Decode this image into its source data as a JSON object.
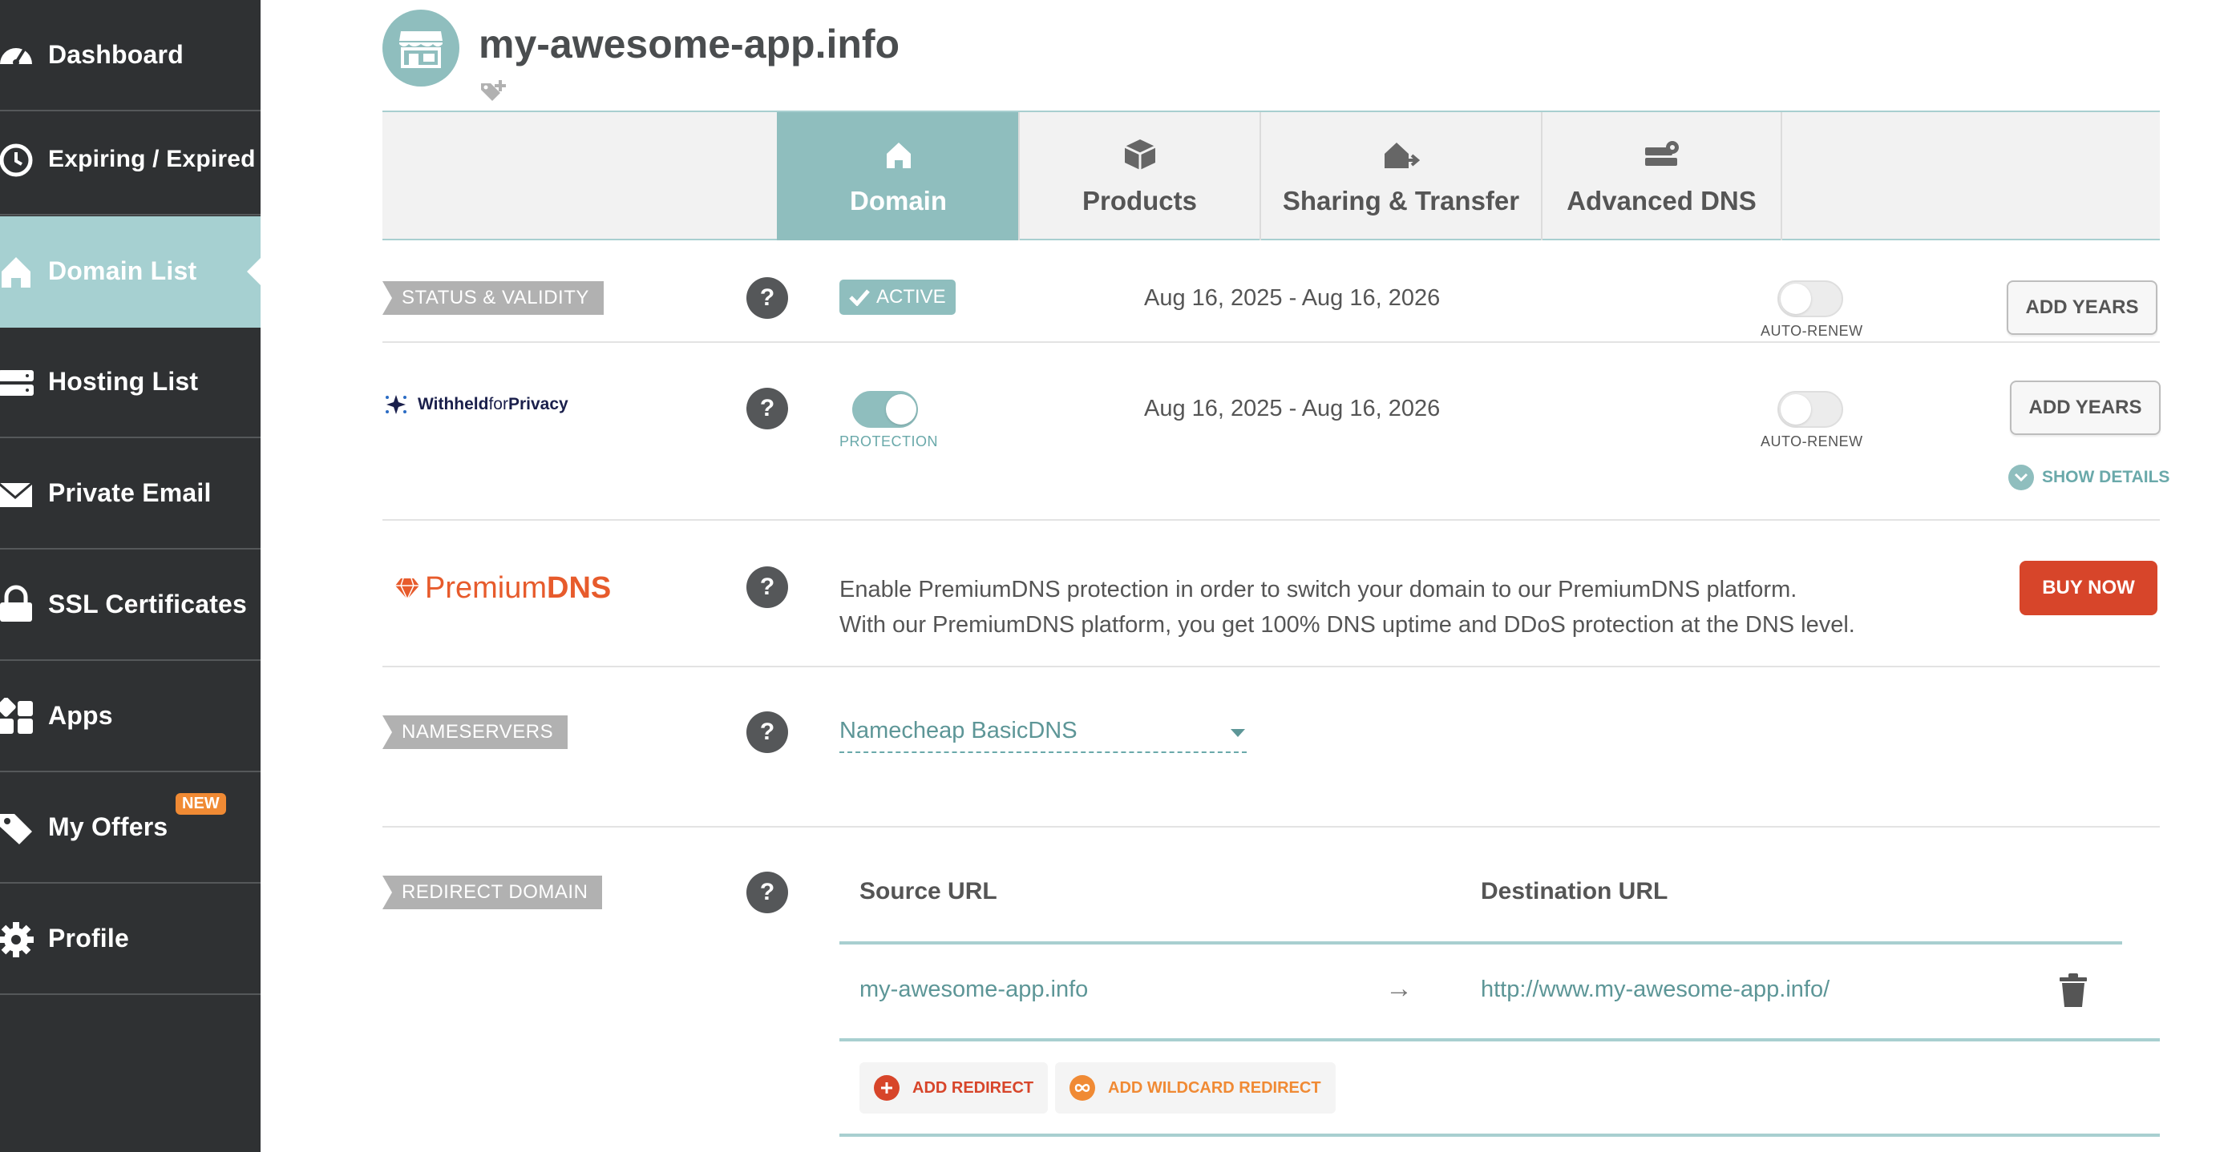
{
  "sidebar": {
    "items": [
      {
        "label": "Dashboard",
        "icon": "gauge-icon"
      },
      {
        "label": "Expiring / Expired",
        "icon": "clock-icon"
      },
      {
        "label": "Domain List",
        "icon": "home-icon"
      },
      {
        "label": "Hosting List",
        "icon": "server-icon"
      },
      {
        "label": "Private Email",
        "icon": "envelope-icon"
      },
      {
        "label": "SSL Certificates",
        "icon": "lock-icon"
      },
      {
        "label": "Apps",
        "icon": "apps-icon"
      },
      {
        "label": "My Offers",
        "icon": "tag-icon",
        "badge": "NEW"
      },
      {
        "label": "Profile",
        "icon": "gear-icon"
      }
    ],
    "active": "Domain List"
  },
  "header": {
    "title": "my-awesome-app.info"
  },
  "tabs": [
    {
      "label": "Domain",
      "icon": "home-icon",
      "active": true
    },
    {
      "label": "Products",
      "icon": "box-icon"
    },
    {
      "label": "Sharing & Transfer",
      "icon": "house-arrow-icon"
    },
    {
      "label": "Advanced DNS",
      "icon": "dns-gear-icon"
    }
  ],
  "status": {
    "tag": "STATUS & VALIDITY",
    "badge": "ACTIVE",
    "dates": "Aug 16, 2025 - Aug 16, 2026",
    "autorenew_label": "AUTO-RENEW",
    "autorenew_on": false,
    "button": "ADD YEARS"
  },
  "privacy": {
    "brand_bold": "Withheld",
    "brand_light": "for",
    "brand_bold2": "Privacy",
    "protection_label": "PROTECTION",
    "protection_on": true,
    "dates": "Aug 16, 2025 - Aug 16, 2026",
    "autorenew_label": "AUTO-RENEW",
    "autorenew_on": false,
    "button": "ADD YEARS",
    "show_details": "SHOW DETAILS"
  },
  "premiumdns": {
    "brand_light": "Premium",
    "brand_bold": "DNS",
    "line1": "Enable PremiumDNS protection in order to switch your domain to our PremiumDNS platform.",
    "line2": "With our PremiumDNS platform, you get 100% DNS uptime and DDoS protection at the DNS level.",
    "button": "BUY NOW"
  },
  "nameservers": {
    "tag": "NAMESERVERS",
    "selected": "Namecheap BasicDNS"
  },
  "redirect": {
    "tag": "REDIRECT DOMAIN",
    "source_header": "Source URL",
    "dest_header": "Destination URL",
    "rows": [
      {
        "source": "my-awesome-app.info",
        "arrow": "→",
        "destination": "http://www.my-awesome-app.info/"
      }
    ],
    "add_redirect": "ADD REDIRECT",
    "add_wildcard": "ADD WILDCARD REDIRECT"
  },
  "help_glyph": "?",
  "colors": {
    "sidebar_bg": "#2f3133",
    "accent_teal": "#8fbebe",
    "buy_red": "#d7452a",
    "badge_orange": "#f08a34",
    "premium_orange": "#e75b2c"
  }
}
